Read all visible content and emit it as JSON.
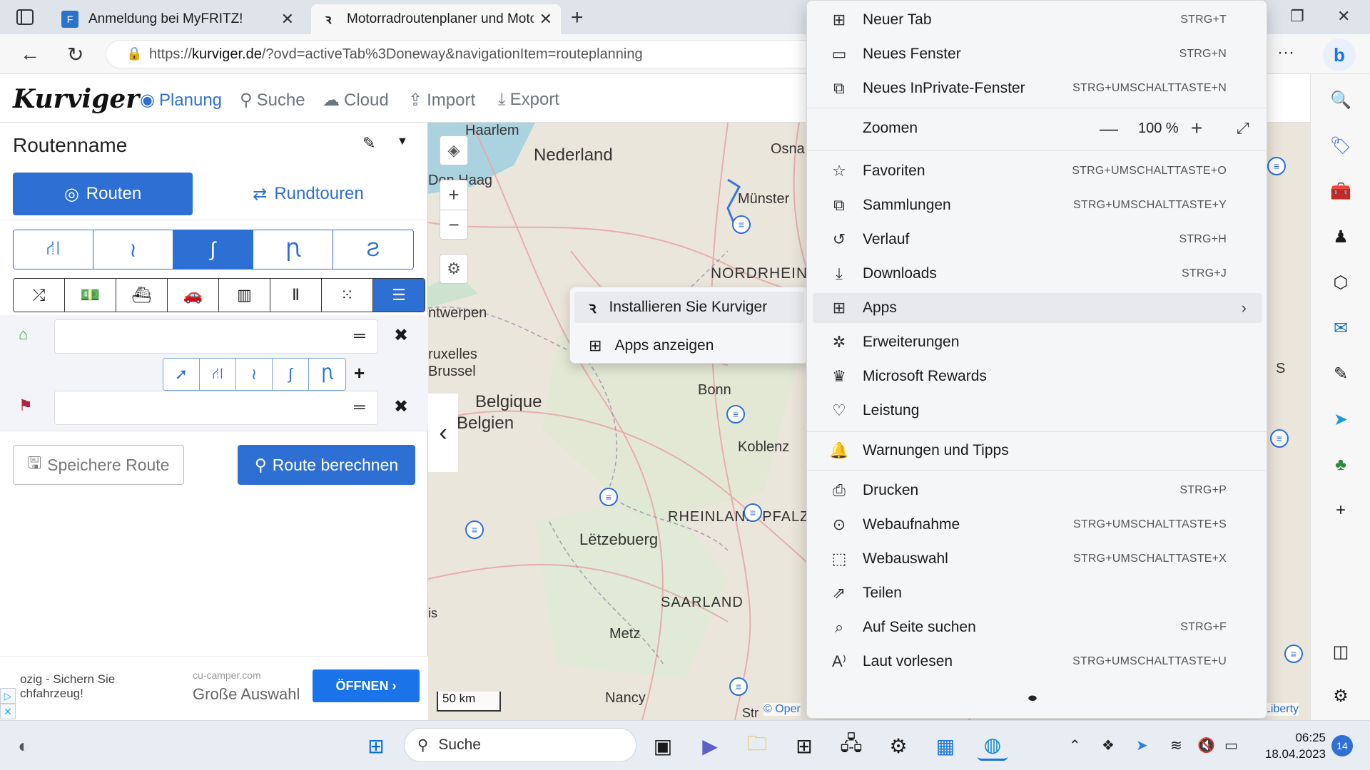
{
  "browser": {
    "tabs": [
      {
        "title": "Anmeldung bei MyFRITZ!",
        "icon": "fritz-icon"
      },
      {
        "title": "Motorradroutenplaner und Moto",
        "icon": "kurviger-icon"
      }
    ],
    "url_prefix": "https://",
    "url_domain": "kurviger.de",
    "url_rest": "/?ovd=activeTab%3Doneway&navigationItem=routeplanning"
  },
  "app": {
    "logo": "Kurviger",
    "nav": [
      "Planung",
      "Suche",
      "Cloud",
      "Import",
      "Export"
    ],
    "active_nav": "Planung"
  },
  "panel": {
    "route_name": "Routenname",
    "btn_routes": "Routen",
    "btn_roundtrips": "Rundtouren",
    "save_route": "Speichere Route",
    "calc_route": "Route berechnen"
  },
  "ad": {
    "text_line1": "ozig - Sichern Sie",
    "text_line2": "chfahrzeug!",
    "domain": "cu-camper.com",
    "headline": "Große Auswahl",
    "cta": "ÖFFNEN"
  },
  "map": {
    "labels": [
      "Haarlem",
      "Nederland",
      "Den Haag",
      "Osna",
      "Münster",
      "NORDRHEIN-",
      "ntwerpen",
      "ruxelles",
      "Brussel",
      "Belgique",
      "Belgien",
      "Bonn",
      "Koblenz",
      "RHEINLAND-PFALZ",
      "Lëtzebuerg",
      "SAARLAND",
      "Metz",
      "Nancy",
      "Str",
      "is",
      "S"
    ],
    "scale": "50 km",
    "attribution": "© Oper",
    "attribution_right": "Liberty"
  },
  "apps_submenu": [
    {
      "label": "Installieren Sie Kurviger",
      "icon": "kurviger-icon"
    },
    {
      "label": "Apps anzeigen",
      "icon": "apps-icon"
    }
  ],
  "menu": {
    "items": [
      {
        "label": "Neuer Tab",
        "shortcut": "STRG+T",
        "icon": "new-tab-icon"
      },
      {
        "label": "Neues Fenster",
        "shortcut": "STRG+N",
        "icon": "new-window-icon"
      },
      {
        "label": "Neues InPrivate-Fenster",
        "shortcut": "STRG+UMSCHALTTASTE+N",
        "icon": "inprivate-icon"
      },
      {
        "label": "Favoriten",
        "shortcut": "STRG+UMSCHALTTASTE+O",
        "icon": "favorites-icon"
      },
      {
        "label": "Sammlungen",
        "shortcut": "STRG+UMSCHALTTASTE+Y",
        "icon": "collections-icon"
      },
      {
        "label": "Verlauf",
        "shortcut": "STRG+H",
        "icon": "history-icon"
      },
      {
        "label": "Downloads",
        "shortcut": "STRG+J",
        "icon": "downloads-icon"
      },
      {
        "label": "Apps",
        "shortcut": "",
        "icon": "apps-icon"
      },
      {
        "label": "Erweiterungen",
        "shortcut": "",
        "icon": "extensions-icon"
      },
      {
        "label": "Microsoft Rewards",
        "shortcut": "",
        "icon": "rewards-icon"
      },
      {
        "label": "Leistung",
        "shortcut": "",
        "icon": "performance-icon"
      },
      {
        "label": "Warnungen und Tipps",
        "shortcut": "",
        "icon": "bell-icon"
      },
      {
        "label": "Drucken",
        "shortcut": "STRG+P",
        "icon": "print-icon"
      },
      {
        "label": "Webaufnahme",
        "shortcut": "STRG+UMSCHALTTASTE+S",
        "icon": "web-capture-icon"
      },
      {
        "label": "Webauswahl",
        "shortcut": "STRG+UMSCHALTTASTE+X",
        "icon": "web-select-icon"
      },
      {
        "label": "Teilen",
        "shortcut": "",
        "icon": "share-icon"
      },
      {
        "label": "Auf Seite suchen",
        "shortcut": "STRG+F",
        "icon": "find-icon"
      },
      {
        "label": "Laut vorlesen",
        "shortcut": "STRG+UMSCHALTTASTE+U",
        "icon": "read-aloud-icon"
      }
    ],
    "zoom_label": "Zoomen",
    "zoom_value": "100 %"
  },
  "taskbar": {
    "search": "Suche",
    "time": "06:25",
    "date": "18.04.2023",
    "notifications": "14"
  }
}
